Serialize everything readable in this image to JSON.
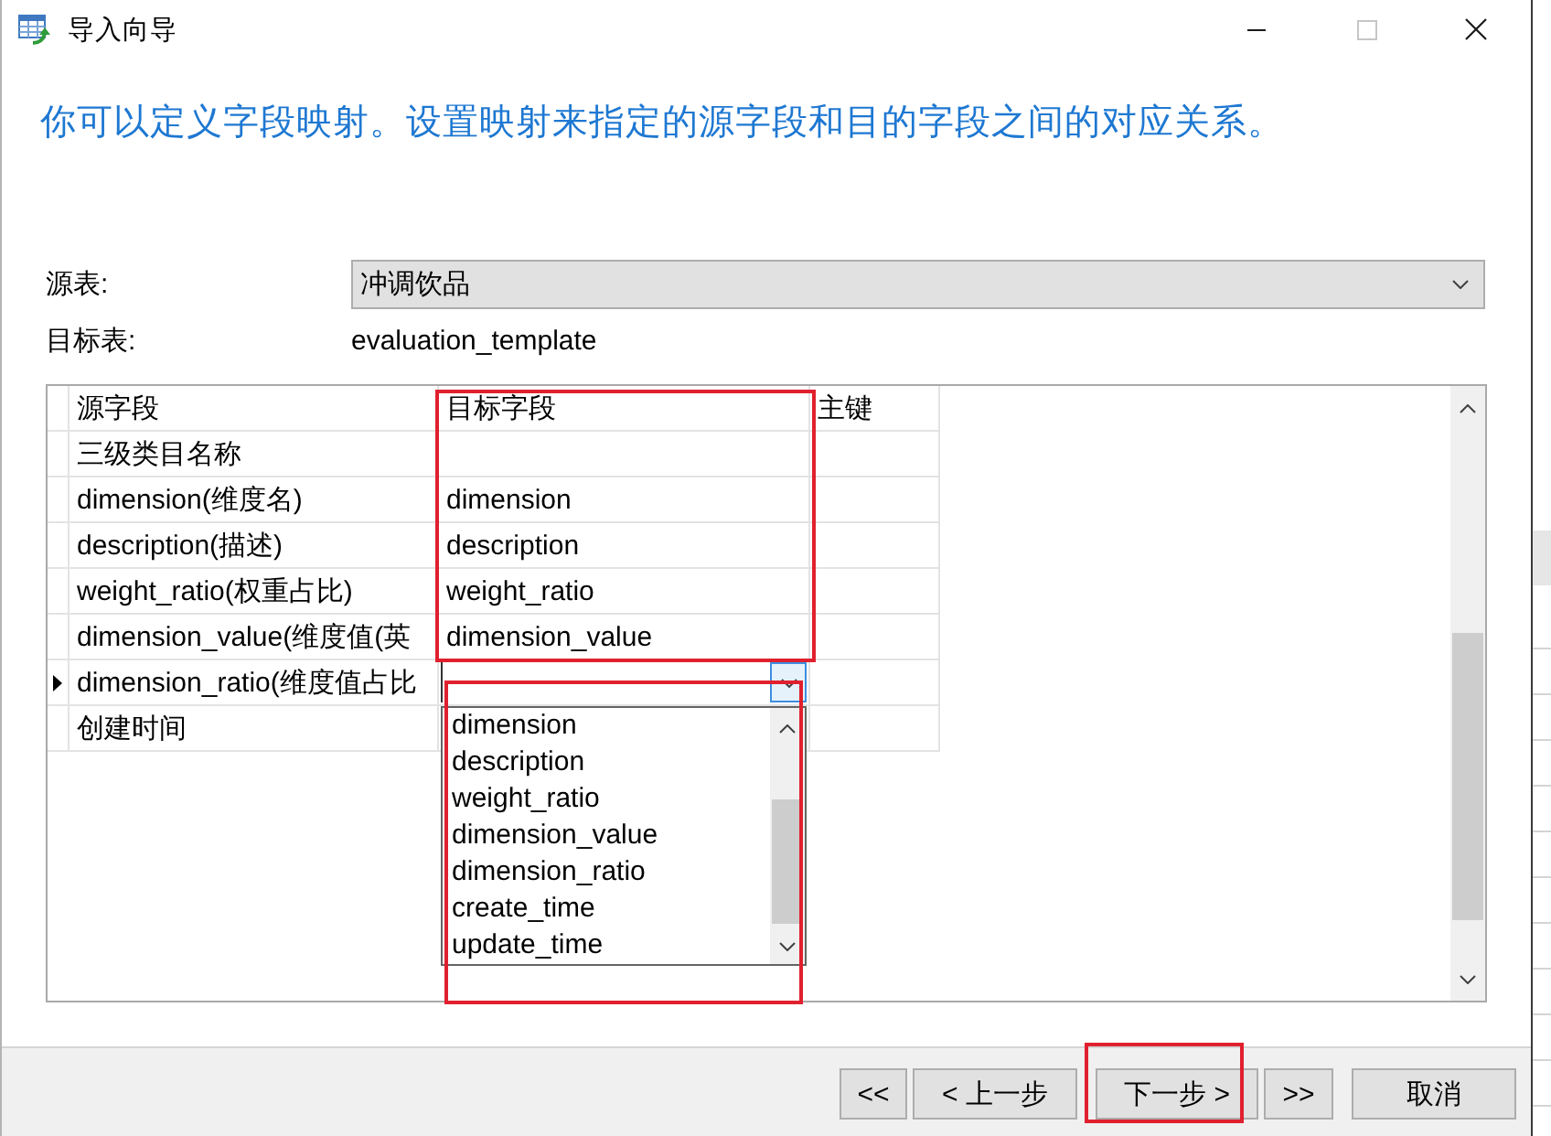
{
  "window": {
    "title": "导入向导",
    "controls": [
      {
        "kind": "minimize",
        "disabled": false
      },
      {
        "kind": "maximize",
        "disabled": true
      },
      {
        "kind": "close",
        "disabled": false
      }
    ]
  },
  "instruction": "你可以定义字段映射。设置映射来指定的源字段和目的字段之间的对应关系。",
  "source_table": {
    "label": "源表:",
    "value": "冲调饮品"
  },
  "target_table": {
    "label": "目标表:",
    "value": "evaluation_template"
  },
  "grid": {
    "columns": [
      {
        "label": "源字段",
        "highlighted": false
      },
      {
        "label": "目标字段",
        "highlighted": true
      },
      {
        "label": "主键",
        "highlighted": false
      }
    ],
    "rows": [
      {
        "source": "三级类目名称",
        "selected": false,
        "editing": false
      },
      {
        "source": "dimension(维度名)",
        "target": "dimension",
        "selected": false,
        "editing": false
      },
      {
        "source": "description(描述)",
        "target": "description",
        "selected": false,
        "editing": false
      },
      {
        "source": "weight_ratio(权重占比)",
        "target": "weight_ratio",
        "selected": false,
        "editing": false
      },
      {
        "source": "dimension_value(维度值(英",
        "target": "dimension_value",
        "selected": false,
        "editing": false
      },
      {
        "source": "dimension_ratio(维度值占比",
        "selected": true,
        "editing": true
      },
      {
        "source": "创建时间",
        "selected": false,
        "editing": false
      }
    ],
    "dropdown": {
      "highlighted": true,
      "options": [
        {
          "label": "dimension",
          "selected": false
        },
        {
          "label": "description",
          "selected": false
        },
        {
          "label": "weight_ratio",
          "selected": false
        },
        {
          "label": "dimension_value",
          "selected": false
        },
        {
          "label": "dimension_ratio",
          "selected": false
        },
        {
          "label": "create_time",
          "selected": false
        },
        {
          "label": "update_time",
          "selected": false
        }
      ]
    }
  },
  "buttons": [
    {
      "label": "<<",
      "highlighted": false
    },
    {
      "label": "< 上一步",
      "highlighted": false
    },
    {
      "label": "下一步 >",
      "highlighted": true
    },
    {
      "label": ">>",
      "highlighted": false
    },
    {
      "label": "取消",
      "highlighted": false
    }
  ]
}
